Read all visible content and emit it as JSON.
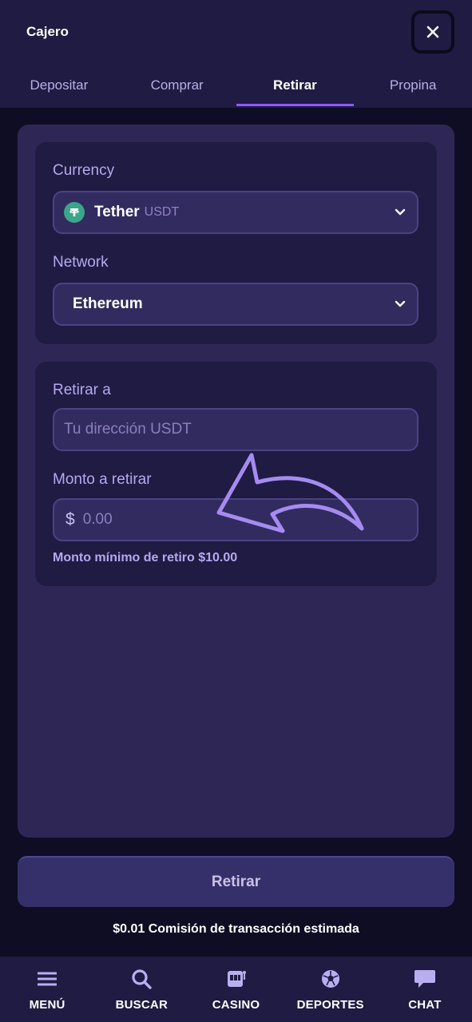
{
  "header": {
    "title": "Cajero",
    "close_icon": "close-icon"
  },
  "tabs": [
    {
      "label": "Depositar",
      "active": false
    },
    {
      "label": "Comprar",
      "active": false
    },
    {
      "label": "Retirar",
      "active": true
    },
    {
      "label": "Propina",
      "active": false
    }
  ],
  "form": {
    "currency_label": "Currency",
    "currency_name": "Tether",
    "currency_code": "USDT",
    "network_label": "Network",
    "network_value": "Ethereum",
    "withdraw_to_label": "Retirar a",
    "address_placeholder": "Tu dirección USDT",
    "amount_label": "Monto a retirar",
    "currency_symbol": "$",
    "amount_placeholder": "0.00",
    "min_hint": "Monto mínimo de retiro $10.00"
  },
  "actions": {
    "withdraw_label": "Retirar",
    "fee_text": "$0.01 Comisión de transacción estimada"
  },
  "bottom_nav": [
    {
      "label": "MENÚ",
      "icon": "menu-icon"
    },
    {
      "label": "BUSCAR",
      "icon": "search-icon"
    },
    {
      "label": "CASINO",
      "icon": "slot-machine-icon"
    },
    {
      "label": "DEPORTES",
      "icon": "soccer-ball-icon"
    },
    {
      "label": "CHAT",
      "icon": "chat-bubble-icon"
    }
  ],
  "colors": {
    "accent": "#8b5cf6",
    "background": "#0f0d24",
    "panel": "#2e2756",
    "card": "#1f1b42",
    "tether_green": "#3aa58a"
  }
}
